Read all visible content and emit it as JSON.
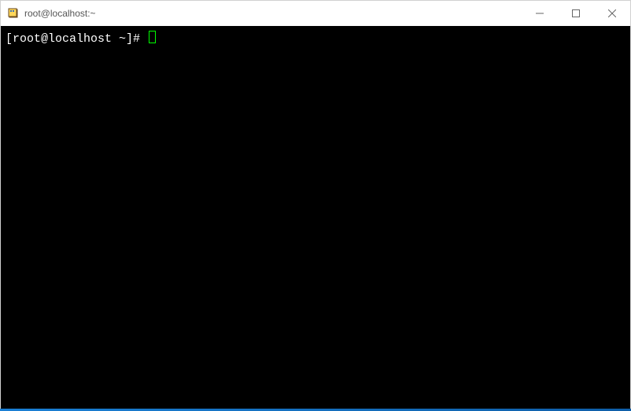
{
  "window": {
    "title": "root@localhost:~"
  },
  "terminal": {
    "prompt": "[root@localhost ~]# "
  }
}
